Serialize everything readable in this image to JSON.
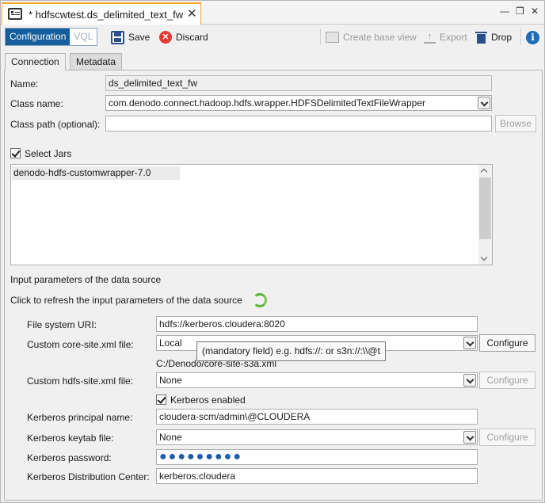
{
  "tab": {
    "title": "* hdfscwtest.ds_delimited_text_fw",
    "close": "✕"
  },
  "window_controls": {
    "minimize": "—",
    "restore": "❐",
    "close": "✕"
  },
  "toolbar": {
    "mode_configuration": "Configuration",
    "mode_vql": "VQL",
    "save": "Save",
    "discard": "Discard",
    "create_base_view": "Create base view",
    "export": "Export",
    "drop": "Drop",
    "info": "i"
  },
  "inner_tabs": {
    "connection": "Connection",
    "metadata": "Metadata"
  },
  "form": {
    "name_label": "Name:",
    "name_value": "ds_delimited_text_fw",
    "class_name_label": "Class name:",
    "class_name_value": "com.denodo.connect.hadoop.hdfs.wrapper.HDFSDelimitedTextFileWrapper",
    "class_path_label": "Class path (optional):",
    "class_path_value": "",
    "browse": "Browse",
    "select_jars_label": "Select Jars",
    "jars": [
      "denodo-hdfs-customwrapper-7.0"
    ],
    "input_params_heading": "Input parameters of the data source",
    "refresh_text": "Click to refresh the input parameters of the data source",
    "fs_uri_label": "File system URI:",
    "fs_uri_value": "hdfs://kerberos.cloudera:8020",
    "core_site_label": "Custom core-site.xml file:",
    "core_site_value": "Local",
    "core_site_path": "C:/Denodo/core-site-s3a.xml",
    "configure": "Configure",
    "tooltip": "(mandatory field) e.g. hdfs://: or s3n://:\\\\@t",
    "hdfs_site_label": "Custom hdfs-site.xml file:",
    "hdfs_site_value": "None",
    "kerberos_enabled_label": "Kerberos enabled",
    "principal_label": "Kerberos principal name:",
    "principal_value": "cloudera-scm/admin\\@CLOUDERA",
    "keytab_label": "Kerberos keytab file:",
    "keytab_value": "None",
    "password_label": "Kerberos password:",
    "password_mask": "●●●●●●●●●",
    "kdc_label": "Kerberos Distribution Center:",
    "kdc_value": "kerberos.cloudera"
  }
}
